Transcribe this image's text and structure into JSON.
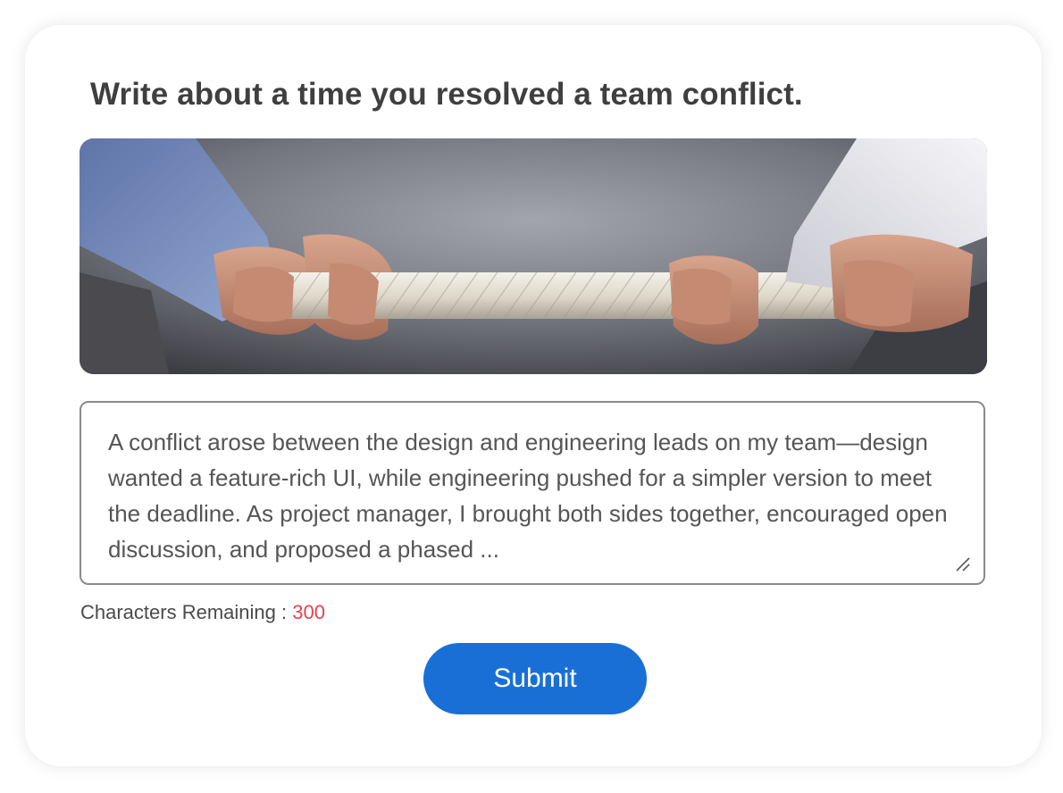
{
  "question": {
    "title": "Write about a time you resolved a team conflict."
  },
  "banner": {
    "image_subject": "hands-pulling-rope-tug-of-war",
    "colors": {
      "background": "#6b6e78",
      "rope": "#e8e3d8",
      "left_sleeve": "#7f95c4",
      "right_sleeve": "#e7e8ee",
      "skin": "#c9917a"
    }
  },
  "answer": {
    "text": "A conflict arose between the design and engineering leads on my team—design wanted a feature-rich UI, while engineering pushed for a simpler version to meet the deadline. As project manager, I brought both sides together, encouraged open discussion, and proposed a phased ..."
  },
  "counter": {
    "label": "Characters Remaining :",
    "value": "300",
    "value_color": "#e8424c"
  },
  "submit": {
    "label": "Submit",
    "color": "#1a6fd6"
  }
}
